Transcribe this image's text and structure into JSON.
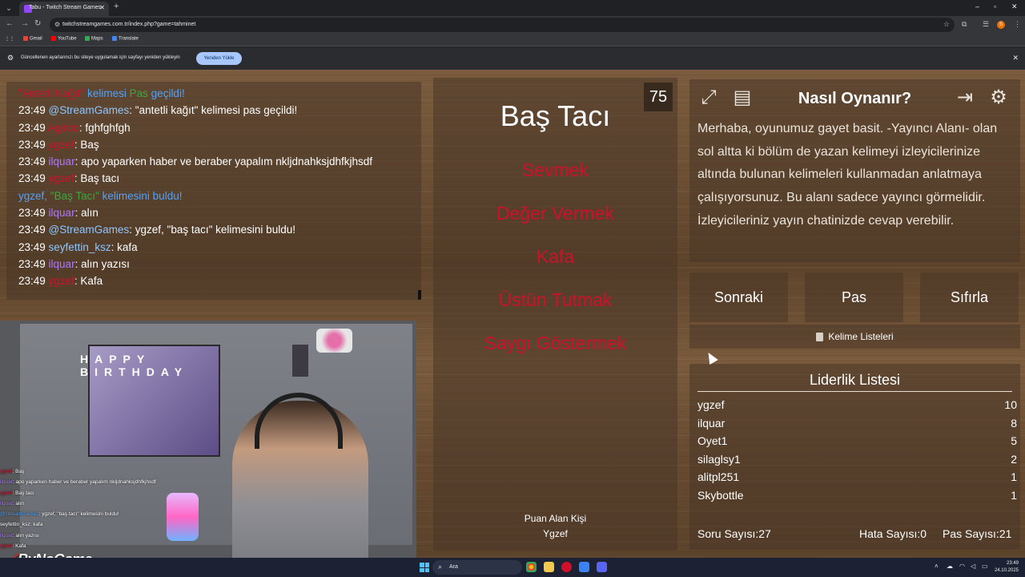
{
  "browser": {
    "tab_title": "Tabu - Twitch Stream Games",
    "tab_close": "✕",
    "new_tab": "+",
    "url": "twitchstreamgames.com.tr/index.php?game=tahminet",
    "bookmarks": [
      "Gmail",
      "YouTube",
      "Maps",
      "Translate"
    ],
    "infobar_text": "Güncellenen ayarlarınızı bu siteye uygulamak için sayfayı yeniden yükleyin",
    "infobar_button": "Yeniden Yükle",
    "profile_initial": "S"
  },
  "chat": {
    "lines": [
      {
        "parts": [
          {
            "t": "\"Antetli Kağıt\"",
            "c": "red"
          },
          {
            "t": " kelimesi ",
            "c": "blue"
          },
          {
            "t": "Pas",
            "c": "green"
          },
          {
            "t": " geçildi!",
            "c": "blue"
          }
        ]
      },
      {
        "parts": [
          {
            "t": "23:49 ",
            "c": "time"
          },
          {
            "t": "@StreamGames",
            "c": "lightblue"
          },
          {
            "t": ": \"antetli kağıt\" kelimesi pas geçildi!",
            "c": "time"
          }
        ]
      },
      {
        "parts": [
          {
            "t": "23:49 ",
            "c": "time"
          },
          {
            "t": "Agirdo",
            "c": "red"
          },
          {
            "t": ": fghfghfgh",
            "c": "time"
          }
        ]
      },
      {
        "parts": [
          {
            "t": "23:49 ",
            "c": "time"
          },
          {
            "t": "ygzef",
            "c": "red"
          },
          {
            "t": ": Baş",
            "c": "time"
          }
        ]
      },
      {
        "parts": [
          {
            "t": "23:49 ",
            "c": "time"
          },
          {
            "t": "ilquar",
            "c": "purple"
          },
          {
            "t": ": apo yaparken haber ve beraber yapalım nkljdnahksjdhfkjhsdf",
            "c": "time"
          }
        ]
      },
      {
        "parts": [
          {
            "t": "23:49 ",
            "c": "time"
          },
          {
            "t": "ygzef",
            "c": "red"
          },
          {
            "t": ": Baş tacı",
            "c": "time"
          }
        ]
      },
      {
        "parts": [
          {
            "t": "ygzef, ",
            "c": "blue"
          },
          {
            "t": "\"Baş Tacı\"",
            "c": "green"
          },
          {
            "t": " kelimesini buldu!",
            "c": "blue"
          }
        ]
      },
      {
        "parts": [
          {
            "t": "23:49 ",
            "c": "time"
          },
          {
            "t": "ilquar",
            "c": "purple"
          },
          {
            "t": ": alın",
            "c": "time"
          }
        ]
      },
      {
        "parts": [
          {
            "t": "23:49 ",
            "c": "time"
          },
          {
            "t": "@StreamGames",
            "c": "lightblue"
          },
          {
            "t": ": ygzef, \"baş tacı\" kelimesini buldu!",
            "c": "time"
          }
        ]
      },
      {
        "parts": [
          {
            "t": "23:49 ",
            "c": "time"
          },
          {
            "t": "seyfettin_ksz",
            "c": "lightblue"
          },
          {
            "t": ": kafa",
            "c": "time"
          }
        ]
      },
      {
        "parts": [
          {
            "t": "23:49 ",
            "c": "time"
          },
          {
            "t": "ilquar",
            "c": "purple"
          },
          {
            "t": ": alın yazısı",
            "c": "time"
          }
        ]
      },
      {
        "parts": [
          {
            "t": "23:49 ",
            "c": "time"
          },
          {
            "t": "ygzef",
            "c": "red"
          },
          {
            "t": ": Kafa",
            "c": "time"
          }
        ]
      }
    ]
  },
  "stream_overlay": {
    "bunting": "HAPPY BIRTHDAY",
    "lines": [
      {
        "user": "ygzef",
        "uc": "red",
        "msg": ": Baş"
      },
      {
        "user": "ilquar",
        "uc": "purple",
        "msg": ": apo yaparken haber ve beraber yapalım nkljdnahksjdhfkjhsdf"
      },
      {
        "user": "ygzef",
        "uc": "red",
        "msg": ": Baş tacı"
      },
      {
        "user": "ilquar",
        "uc": "purple",
        "msg": ": alın"
      },
      {
        "user": "@StreamGames",
        "uc": "blue",
        "msg": ": ygzef, \"baş tacı\" kelimesini buldu!"
      },
      {
        "user": "seyfettin_ksz",
        "uc": "none",
        "msg": ": kafa"
      },
      {
        "user": "ilquar",
        "uc": "purple",
        "msg": ": alın yazısı"
      },
      {
        "user": "ygzef",
        "uc": "red",
        "msg": ": Kafa"
      }
    ],
    "logo": "ByNoGame"
  },
  "card": {
    "timer": "75",
    "word": "Baş Tacı",
    "taboo_words": [
      "Sevmek",
      "Değer Vermek",
      "Kafa",
      "Üstün Tutmak",
      "Saygı Göstermek"
    ],
    "winner_label": "Puan Alan Kişi",
    "winner_name": "Ygzef"
  },
  "howto": {
    "title": "Nasıl Oynanır?",
    "text": "Merhaba, oyunumuz gayet basit. -Yayıncı Alanı- olan sol altta ki bölüm de yazan kelimeyi izleyicilerinize altında bulunan kelimeleri kullanmadan anlatmaya çalışıyorsunuz. Bu alanı sadece yayıncı görmelidir. İzleyicileriniz yayın chatinizde cevap verebilir."
  },
  "controls": {
    "next": "Sonraki",
    "pass": "Pas",
    "reset": "Sıfırla",
    "word_lists": "Kelime Listeleri"
  },
  "leaderboard": {
    "title": "Liderlik Listesi",
    "rows": [
      {
        "name": "ygzef",
        "score": "10"
      },
      {
        "name": "ilquar",
        "score": "8"
      },
      {
        "name": "Oyet1",
        "score": "5"
      },
      {
        "name": "silaglsy1",
        "score": "2"
      },
      {
        "name": "alitpl251",
        "score": "1"
      },
      {
        "name": "Skybottle",
        "score": "1"
      }
    ],
    "questions_label": "Soru Sayısı:",
    "questions_value": "27",
    "errors_label": "Hata Sayısı:",
    "errors_value": "0",
    "passes_label": "Pas Sayısı:",
    "passes_value": "21"
  },
  "taskbar": {
    "search_placeholder": "Ara",
    "time": "23:49",
    "date": "24.10.2025"
  },
  "colors": {
    "taboo_red": "#d0102a",
    "chat_blue": "#4fa3ff",
    "chat_green": "#3fa63f",
    "chat_purple": "#b077ff",
    "accent_button": "#a8c7fa"
  }
}
